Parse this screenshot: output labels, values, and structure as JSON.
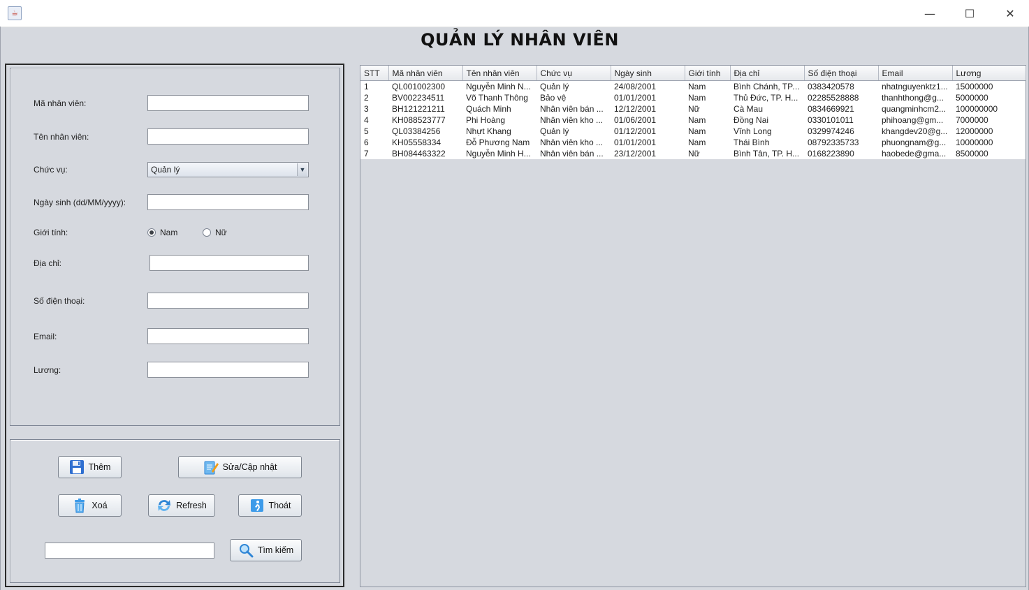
{
  "window": {
    "minimize": "—",
    "maximize": "☐",
    "close": "✕"
  },
  "page_title": "QUẢN LÝ NHÂN VIÊN",
  "form": {
    "ma_nv_label": "Mã nhân viên:",
    "ten_nv_label": "Tên nhân viên:",
    "chuc_vu_label": "Chức vụ:",
    "chuc_vu_value": "Quản lý",
    "ngay_sinh_label": "Ngày sinh (dd/MM/yyyy):",
    "gioi_tinh_label": "Giới tính:",
    "nam_label": "Nam",
    "nu_label": "Nữ",
    "gioi_tinh_selected": "Nam",
    "dia_chi_label": "Địa chỉ:",
    "sdt_label": "Số điện thoại:",
    "email_label": "Email:",
    "luong_label": "Lương:",
    "ma_nv_value": "",
    "ten_nv_value": "",
    "ngay_sinh_value": "",
    "dia_chi_value": "",
    "sdt_value": "",
    "email_value": "",
    "luong_value": ""
  },
  "buttons": {
    "them": "Thêm",
    "sua": "Sửa/Cập nhật",
    "xoa": "Xoá",
    "refresh": "Refresh",
    "thoat": "Thoát",
    "tim_kiem": "Tìm kiếm"
  },
  "search": {
    "value": ""
  },
  "table": {
    "columns": [
      "STT",
      "Mã nhân viên",
      "Tên nhân viên",
      "Chức vụ",
      "Ngày sinh",
      "Giới tính",
      "Địa chỉ",
      "Số điện thoại",
      "Email",
      "Lương"
    ],
    "rows": [
      [
        "1",
        "QL001002300",
        "Nguyễn Minh N...",
        "Quản lý",
        "24/08/2001",
        "Nam",
        "Bình Chánh, TP....",
        "0383420578",
        "nhatnguyenktz1...",
        "15000000"
      ],
      [
        "2",
        "BV002234511",
        "Võ Thanh Thông",
        "Bảo vệ",
        "01/01/2001",
        "Nam",
        "Thủ Đức, TP. H...",
        "02285528888",
        "thanhthong@g...",
        "5000000"
      ],
      [
        "3",
        "BH121221211",
        "Quách Minh",
        "Nhân viên bán ...",
        "12/12/2001",
        "Nữ",
        "Cà Mau",
        "0834669921",
        "quangminhcm2...",
        "100000000"
      ],
      [
        "4",
        "KH088523777",
        "Phi Hoàng",
        "Nhân viên kho ...",
        "01/06/2001",
        "Nam",
        "Đồng Nai",
        "0330101011",
        "phihoang@gm...",
        "7000000"
      ],
      [
        "5",
        "QL03384256",
        "Nhựt Khang",
        "Quản lý",
        "01/12/2001",
        "Nam",
        "Vĩnh Long",
        "0329974246",
        "khangdev20@g...",
        "12000000"
      ],
      [
        "6",
        "KH05558334",
        "Đỗ Phương Nam",
        "Nhân viên kho ...",
        "01/01/2001",
        "Nam",
        "Thái Bình",
        "08792335733",
        "phuongnam@g...",
        "10000000"
      ],
      [
        "7",
        "BH084463322",
        "Nguyễn Minh H...",
        "Nhân viên bán ...",
        "23/12/2001",
        "Nữ",
        "Bình Tân, TP. H...",
        "0168223890",
        "haobede@gma...",
        "8500000"
      ]
    ]
  },
  "colors": {
    "background": "#d6d9df",
    "title_text": "#111111",
    "icon_blue": "#2f86d6"
  }
}
